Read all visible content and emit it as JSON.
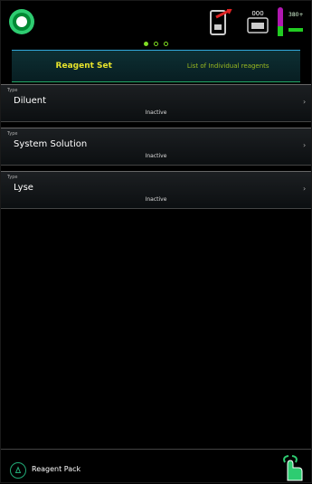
{
  "header": {
    "tab_active": "Reagent Set",
    "tab_other": "List of Individual reagents",
    "level": "380+"
  },
  "reagents": [
    {
      "type_label": "Type",
      "name": "Diluent",
      "status": "Inactive"
    },
    {
      "type_label": "Type",
      "name": "System Solution",
      "status": "Inactive"
    },
    {
      "type_label": "Type",
      "name": "Lyse",
      "status": "Inactive"
    }
  ],
  "counter": "000",
  "footer": {
    "label": "Reagent Pack"
  },
  "colors": {
    "accent": "#7fdc23",
    "tab_active": "#e6e22b"
  }
}
